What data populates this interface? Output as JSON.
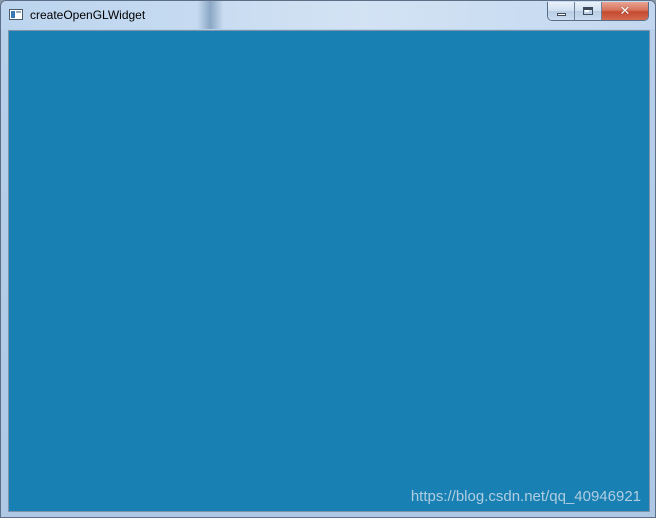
{
  "window": {
    "title": "createOpenGLWidget",
    "icon": "app-window-icon",
    "controls": {
      "minimize_icon": "minimize-icon",
      "maximize_icon": "maximize-icon",
      "close_icon": "close-icon",
      "close_glyph": "✕"
    }
  },
  "gl_widget": {
    "clear_color": "#1980b4"
  },
  "watermark": {
    "text": "https://blog.csdn.net/qq_40946921"
  }
}
